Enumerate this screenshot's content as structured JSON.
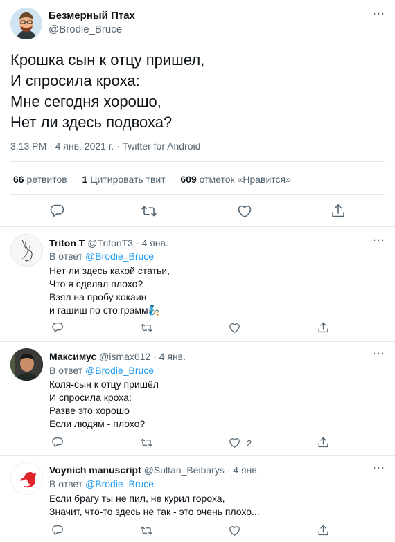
{
  "tweet": {
    "author_name": "Безмерный Птах",
    "author_handle": "@Brodie_Bruce",
    "lines": [
      "Крошка сын к отцу пришел,",
      "И спросила кроха:",
      "Мне сегодня хорошо,",
      "Нет ли здесь подвоха?"
    ],
    "meta": "3:13 PM · 4 янв. 2021 г. · Twitter for Android",
    "retweets_num": "66",
    "retweets_label": "ретвитов",
    "quotes_num": "1",
    "quotes_label": "Цитировать твит",
    "likes_num": "609",
    "likes_label": "отметок «Нравится»"
  },
  "replies": [
    {
      "name": "Triton T",
      "handle_date": "@TritonT3 · 4 янв.",
      "replying_prefix": "В ответ",
      "mention": "@Brodie_Bruce",
      "text": "Нет ли здесь какой статьи,\nЧто я сделал плохо?\nВзял на пробу кокаин\nи гашиш по сто грамм",
      "emoji": "🧞",
      "like_count": ""
    },
    {
      "name": "Максимус",
      "handle_date": "@ismax612 · 4 янв.",
      "replying_prefix": "В ответ",
      "mention": "@Brodie_Bruce",
      "text": "Коля-сын к отцу пришёл\nИ спросила кроха:\nРазве это хорошо\nЕсли людям - плохо?",
      "like_count": "2"
    },
    {
      "name": "Voynich manuscript",
      "handle_date": "@Sultan_Beibarys · 4 янв.",
      "replying_prefix": "В ответ",
      "mention": "@Brodie_Bruce",
      "text": "Если брагу ты не пил, не курил гороха,\nЗначит, что-то здесь не так - это очень плохо...",
      "like_count": ""
    }
  ],
  "icons": {
    "reply": "reply-icon",
    "retweet": "retweet-icon",
    "like": "like-icon",
    "share": "share-icon",
    "more": "more-icon"
  },
  "colors": {
    "link": "#1d9bf0",
    "secondary": "#536471",
    "text": "#0f1419",
    "divider": "#e1e8ed"
  }
}
